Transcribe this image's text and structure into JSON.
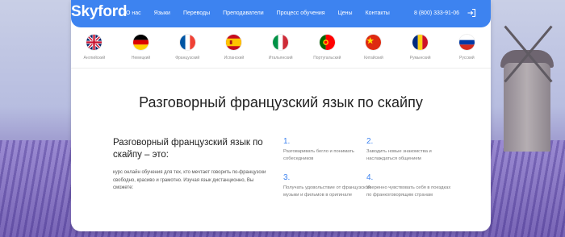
{
  "header": {
    "logo": "Skyford",
    "nav": [
      "О нас",
      "Языки",
      "Переводы",
      "Преподаватели",
      "Процесс обучения",
      "Цены",
      "Контакты"
    ],
    "phone": "8 (800) 333-91-06",
    "login_icon": "login-icon"
  },
  "languages": [
    {
      "label": "Английский",
      "flag": "uk"
    },
    {
      "label": "Немецкий",
      "flag": "de"
    },
    {
      "label": "Французский",
      "flag": "fr"
    },
    {
      "label": "Испанский",
      "flag": "es"
    },
    {
      "label": "Итальянский",
      "flag": "it"
    },
    {
      "label": "Португальский",
      "flag": "pt"
    },
    {
      "label": "Китайский",
      "flag": "cn"
    },
    {
      "label": "Румынский",
      "flag": "ro"
    },
    {
      "label": "Русский",
      "flag": "ru"
    }
  ],
  "main": {
    "title": "Разговорный французский язык по скайпу",
    "subtitle": "Разговорный французский язык по скайпу – это:",
    "description": "курс онлайн обучения для тех, кто мечтает говорить по-французски свободно, красиво и грамотно. Изучая язык дистанционно, Вы сможете:",
    "points": [
      {
        "num": "1.",
        "text": "Разговаривать бегло и понимать собеседников"
      },
      {
        "num": "2.",
        "text": "Заводить новые знакомства и наслаждаться общением"
      },
      {
        "num": "3.",
        "text": "Получать удовольствие от французской музыки и фильмов в оригинале"
      },
      {
        "num": "4.",
        "text": "Уверенно чувствовать себя в поездках по франкоговорящим странам"
      }
    ]
  },
  "colors": {
    "accent": "#3d83f0"
  }
}
